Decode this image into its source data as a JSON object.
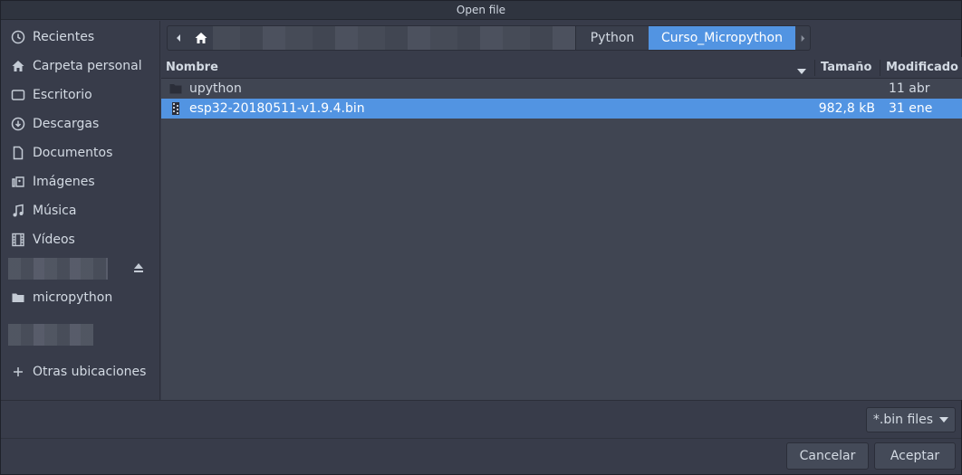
{
  "window": {
    "title": "Open file"
  },
  "sidebar": {
    "items": [
      {
        "label": "Recientes",
        "icon": "clock-icon"
      },
      {
        "label": "Carpeta personal",
        "icon": "home-icon"
      },
      {
        "label": "Escritorio",
        "icon": "desktop-icon"
      },
      {
        "label": "Descargas",
        "icon": "download-icon"
      },
      {
        "label": "Documentos",
        "icon": "document-icon"
      },
      {
        "label": "Imágenes",
        "icon": "image-icon"
      },
      {
        "label": "Música",
        "icon": "music-icon"
      },
      {
        "label": "Vídeos",
        "icon": "video-icon"
      },
      {
        "label": "micropython",
        "icon": "folder-icon"
      },
      {
        "label": "Otras ubicaciones",
        "icon": "plus-icon"
      }
    ]
  },
  "pathbar": {
    "segments": [
      "Python",
      "Curso_Micropython"
    ]
  },
  "filelist": {
    "columns": {
      "name": "Nombre",
      "size": "Tamaño",
      "modified": "Modificado"
    },
    "rows": [
      {
        "name": "upython",
        "size": "",
        "modified": "11 abr",
        "type": "folder",
        "selected": false
      },
      {
        "name": "esp32-20180511-v1.9.4.bin",
        "size": "982,8 kB",
        "modified": "31 ene",
        "type": "binary",
        "selected": true
      }
    ]
  },
  "filter": {
    "label": "*.bin files"
  },
  "buttons": {
    "cancel": "Cancelar",
    "accept": "Aceptar"
  },
  "colors": {
    "accent": "#5294e2",
    "background": "#383c4a",
    "list_bg": "#404552"
  }
}
